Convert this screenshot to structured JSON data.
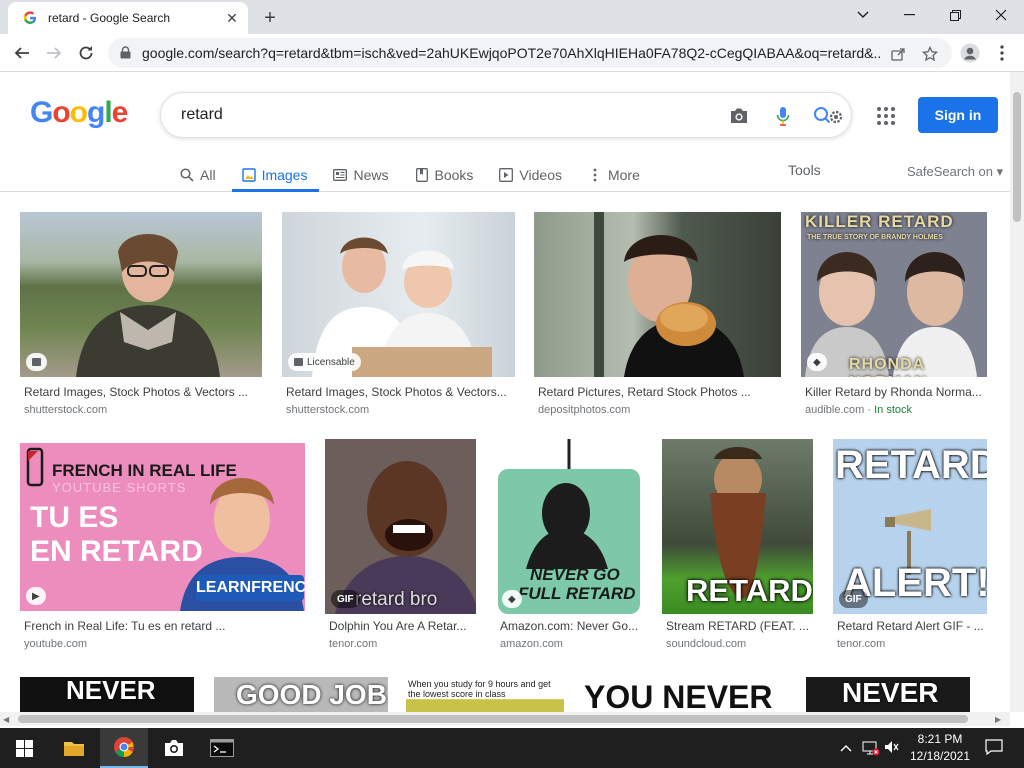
{
  "browser": {
    "tab_title": "retard - Google Search",
    "url": "google.com/search?q=retard&tbm=isch&ved=2ahUKEwjqoPOT2e70AhXlqHIEHa0FA78Q2-cCegQIABAA&oq=retard&..."
  },
  "google": {
    "query": "retard",
    "signin_label": "Sign in",
    "tabs": [
      {
        "label": "All",
        "icon": "search-icon"
      },
      {
        "label": "Images",
        "icon": "image-icon"
      },
      {
        "label": "News",
        "icon": "news-icon"
      },
      {
        "label": "Books",
        "icon": "book-icon"
      },
      {
        "label": "Videos",
        "icon": "video-icon"
      },
      {
        "label": "More",
        "icon": "more-dots-icon"
      }
    ],
    "tools_label": "Tools",
    "safesearch_label": "SafeSearch on"
  },
  "results": [
    {
      "caption": "Retard Images, Stock Photos & Vectors ...",
      "source": "shutterstock.com"
    },
    {
      "caption": "Retard Images, Stock Photos & Vectors...",
      "source": "shutterstock.com",
      "badge": "Licensable"
    },
    {
      "caption": "Retard Pictures, Retard Stock Photos ...",
      "source": "depositphotos.com"
    },
    {
      "caption": "Killer Retard by Rhonda Norma...",
      "source": "audible.com",
      "stock": "In stock",
      "img_text": [
        "KILLER RETARD",
        "THE TRUE STORY OF BRANDY HOLMES",
        "RHONDA NORMAN"
      ]
    },
    {
      "caption": "French in Real Life: Tu es en retard ...",
      "source": "youtube.com",
      "img_text": [
        "FRENCH IN REAL LIFE",
        "YOUTUBE SHORTS",
        "TU ES",
        "EN RETARD",
        "LEARNFRENCH.COM"
      ]
    },
    {
      "caption": "Dolphin You Are A Retar...",
      "source": "tenor.com",
      "badge": "GIF",
      "img_text": [
        "retard bro"
      ]
    },
    {
      "caption": "Amazon.com: Never Go...",
      "source": "amazon.com",
      "img_text": [
        "NEVER GO",
        "FULL RETARD"
      ]
    },
    {
      "caption": "Stream RETARD (FEAT. ...",
      "source": "soundcloud.com",
      "img_text": [
        "RETARD"
      ]
    },
    {
      "caption": "Retard Retard Alert GIF - ...",
      "source": "tenor.com",
      "badge": "GIF",
      "img_text": [
        "RETARD",
        "ALERT!"
      ]
    }
  ],
  "partial_row": [
    "NEVER",
    "GOOD JOB",
    "When you study for 9 hours and get the lowest score in class",
    "YOU NEVER G",
    "NEVER"
  ],
  "taskbar": {
    "time": "8:21 PM",
    "date": "12/18/2021"
  }
}
